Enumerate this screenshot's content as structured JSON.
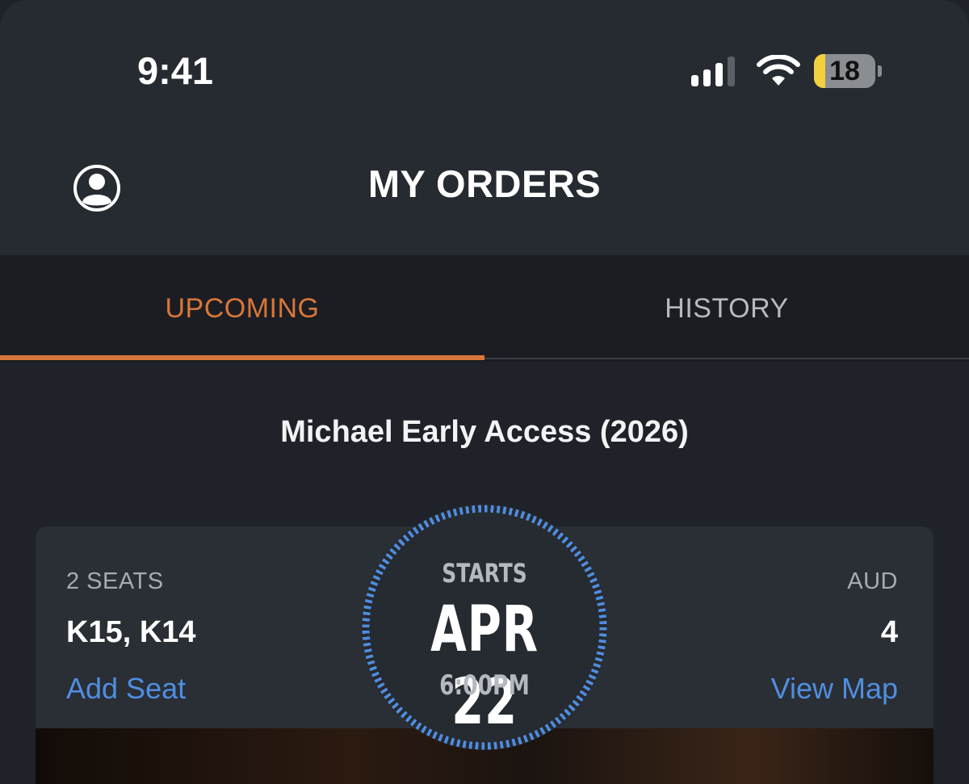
{
  "status_bar": {
    "time": "9:41",
    "signal_bars_active": 3,
    "signal_bars_total": 4,
    "battery_level": "18",
    "battery_fraction": 0.18,
    "battery_color": "#f3d03e"
  },
  "header": {
    "title": "MY ORDERS",
    "profile_icon": "user-circle-icon"
  },
  "tabs": [
    {
      "label": "UPCOMING",
      "active": true
    },
    {
      "label": "HISTORY",
      "active": false
    }
  ],
  "order": {
    "movie_title": "Michael Early Access (2026)",
    "seats_label": "2 SEATS",
    "seats": "K15, K14",
    "add_seat_label": "Add Seat",
    "starts_label": "STARTS",
    "date": "APR 22",
    "time": "6:00PM",
    "auditorium_label": "AUD",
    "auditorium": "4",
    "view_map_label": "View Map"
  },
  "colors": {
    "accent": "#d8763a",
    "link": "#4f8ee0",
    "background": "#1f2228"
  }
}
